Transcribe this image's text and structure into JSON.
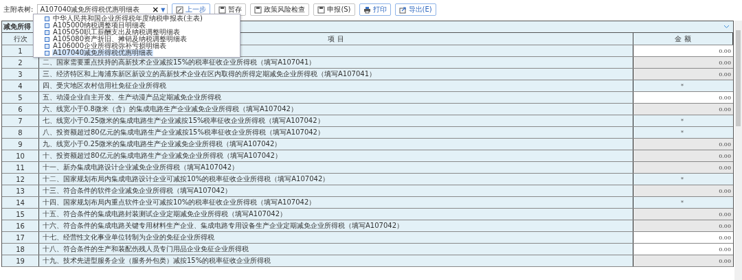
{
  "toolbar": {
    "label": "主附表树:",
    "select": {
      "value": "A107040减免所得税优惠明细表",
      "clear": "×",
      "caret": "▼"
    },
    "buttons": [
      {
        "label": "上一步",
        "kind": "edit",
        "highlighted": true
      },
      {
        "label": "暂存",
        "kind": "save",
        "highlighted": false
      },
      {
        "label": "政策风险检查",
        "kind": "save",
        "highlighted": false
      },
      {
        "label": "申报(S)",
        "kind": "save",
        "highlighted": false
      },
      {
        "label": "打印",
        "kind": "print",
        "highlighted": true
      },
      {
        "label": "导出(E)",
        "kind": "export",
        "highlighted": true
      }
    ]
  },
  "dropdown": {
    "items": [
      {
        "label": "中华人民共和国企业所得税年度纳税申报表(主表)",
        "selected": false
      },
      {
        "label": "A105000纳税调整项目明细表",
        "selected": false
      },
      {
        "label": "A105050职工薪酬支出及纳税调整明细表",
        "selected": false
      },
      {
        "label": "A105080资产折旧、摊销及纳税调整明细表",
        "selected": false
      },
      {
        "label": "A106000企业所得税弥补亏损明细表",
        "selected": false
      },
      {
        "label": "A107040减免所得税优惠明细表",
        "selected": true
      }
    ]
  },
  "table": {
    "title": "减免所得",
    "columns": [
      "行次",
      "项 目",
      "金 额"
    ],
    "rows": [
      {
        "no": "1",
        "kind": "input",
        "amount": "0.00"
      },
      {
        "no": "2",
        "item": "二、国家需要重点扶持的高新技术企业减按15%的税率征收企业所得税（填写A107041）",
        "kind": "calc",
        "amount": "0.00"
      },
      {
        "no": "3",
        "item": "三、经济特区和上海浦东新区新设立的高新技术企业在区内取得的所得定期减免企业所得税（填写A107041）",
        "kind": "calc",
        "amount": "0.00"
      },
      {
        "no": "4",
        "item": "四、受灾地区农村信用社免征企业所得税",
        "kind": "na",
        "amount": "*"
      },
      {
        "no": "5",
        "item": "五、动漫企业自主开发、生产动漫产品定期减免企业所得税",
        "kind": "input",
        "amount": "0.00"
      },
      {
        "no": "6",
        "item": "六、线宽小于0.8微米（含）的集成电路生产企业减免企业所得税（填写A107042）",
        "kind": "calc",
        "amount": "0.00"
      },
      {
        "no": "7",
        "item": "七、线宽小于0.25微米的集成电路生产企业减按15%税率征收企业所得税（填写A107042）",
        "kind": "na",
        "amount": "*"
      },
      {
        "no": "8",
        "item": "八、投资额超过80亿元的集成电路生产企业减按15%税率征收企业所得税（填写A107042）",
        "kind": "na",
        "amount": "*"
      },
      {
        "no": "9",
        "item": "九、线宽小于0.25微米的集成电路生产企业减免企业所得税（填写A107042）",
        "kind": "calc",
        "amount": "0.00"
      },
      {
        "no": "10",
        "item": "十、投资额超过80亿元的集成电路生产企业减免企业所得税（填写A107042）",
        "kind": "calc",
        "amount": "0.00"
      },
      {
        "no": "11",
        "item": "十一、新办集成电路设计企业减免企业所得税（填写A107042）",
        "kind": "calc",
        "amount": "0.00"
      },
      {
        "no": "12",
        "item": "十二、国家规划布局内集成电路设计企业可减按10%的税率征收企业所得税（填写A107042）",
        "kind": "na",
        "amount": "*"
      },
      {
        "no": "13",
        "item": "十三、符合条件的软件企业减免企业所得税（填写A107042）",
        "kind": "calc",
        "amount": "0.00"
      },
      {
        "no": "14",
        "item": "十四、国家规划布局内重点软件企业可减按10%的税率征收企业所得税（填写A107042）",
        "kind": "na",
        "amount": "*"
      },
      {
        "no": "15",
        "item": "十五、符合条件的集成电路封装测试企业定期减免企业所得税（填写A107042）",
        "kind": "calc",
        "amount": "0.00"
      },
      {
        "no": "16",
        "item": "十六、符合条件的集成电路关键专用材料生产企业、集成电路专用设备生产企业定期减免企业所得税（填写A107042）",
        "kind": "calc",
        "amount": "0.00"
      },
      {
        "no": "17",
        "item": "十七、经营性文化事业单位转制为企业的免征企业所得税",
        "kind": "input",
        "amount": "0.00"
      },
      {
        "no": "18",
        "item": "十八、符合条件的生产和装配伤残人员专门用品企业免征企业所得税",
        "kind": "input",
        "amount": "0.00"
      },
      {
        "no": "19",
        "item": "十九、技术先进型服务企业（服务外包类）减按15%的税率征收企业所得税",
        "kind": "calc",
        "amount": "0.00"
      }
    ]
  }
}
